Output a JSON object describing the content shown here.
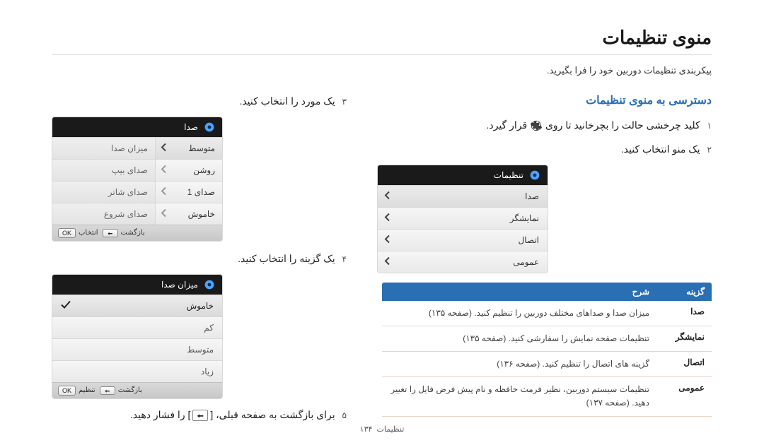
{
  "page": {
    "title": "منوی تنظیمات",
    "subtitle": "پیکربندی تنظیمات دوربین خود را فرا بگیرید.",
    "footer_section": "تنظیمات",
    "footer_page": "۱۳۴"
  },
  "right": {
    "section": "دسترسی به منوی تنظیمات",
    "step1_pre": "کلید چرخشی حالت را بچرخانید تا روی ",
    "step1_post": " قرار گیرد.",
    "step2": "یک منو انتخاب کنید.",
    "menu1": {
      "header": "تنظیمات",
      "items": [
        "صدا",
        "نمایشگر",
        "اتصال",
        "عمومی"
      ]
    },
    "opts": {
      "h1": "گزینه",
      "h2": "شرح",
      "rows": [
        {
          "k": "صدا",
          "v": "میزان صدا و صداهای مختلف دوربین را تنظیم کنید. (صفحه ۱۳۵)"
        },
        {
          "k": "نمایشگر",
          "v": "تنظیمات صفحه نمایش را سفارشی کنید. (صفحه ۱۳۵)"
        },
        {
          "k": "اتصال",
          "v": "گزینه های اتصال را تنظیم کنید. (صفحه ۱۳۶)"
        },
        {
          "k": "عمومی",
          "v": "تنظیمات سیستم دوربین، نظیر فرمت حافظه و نام پیش فرض فایل را تغییر دهید. (صفحه ۱۳۷)"
        }
      ]
    }
  },
  "left": {
    "step3": "یک مورد را انتخاب کنید.",
    "menu2": {
      "header": "صدا",
      "rows": [
        {
          "c1": "متوسط",
          "c2": "میزان صدا",
          "sel": true
        },
        {
          "c1": "روشن",
          "c2": "صدای بیپ"
        },
        {
          "c1": "صدای 1",
          "c2": "صدای شاتر"
        },
        {
          "c1": "خاموش",
          "c2": "صدای شروع"
        }
      ],
      "btn_ok": "OK",
      "btn_ok_label": "انتخاب",
      "btn_back": "بازگشت"
    },
    "step4": "یک گزینه را انتخاب کنید.",
    "menu3": {
      "header": "میزان صدا",
      "items": [
        {
          "t": "خاموش",
          "sel": true
        },
        {
          "t": "کم"
        },
        {
          "t": "متوسط"
        },
        {
          "t": "زیاد"
        }
      ],
      "btn_ok": "OK",
      "btn_ok_label": "تنظیم",
      "btn_back": "بازگشت"
    },
    "step5_pre": "برای بازگشت به صفحه قبلی، [",
    "step5_post": "] را فشار دهید."
  }
}
